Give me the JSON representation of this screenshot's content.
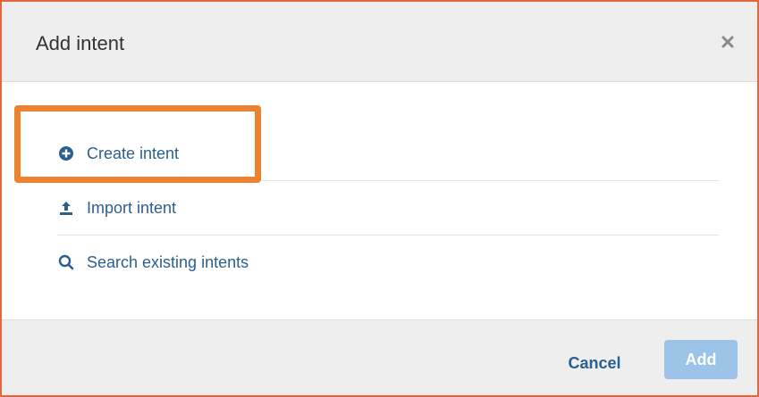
{
  "dialog": {
    "title": "Add intent",
    "close_icon": "close-icon",
    "options": [
      {
        "label": "Create intent",
        "icon": "plus-circle-icon"
      },
      {
        "label": "Import intent",
        "icon": "upload-icon"
      },
      {
        "label": "Search existing intents",
        "icon": "search-icon"
      }
    ],
    "cancel_label": "Cancel",
    "add_label": "Add",
    "add_enabled": false
  },
  "colors": {
    "link": "#2b5f8e",
    "highlight": "#ec8230",
    "frame": "#e2673f",
    "add_disabled": "#9cc3e8"
  }
}
